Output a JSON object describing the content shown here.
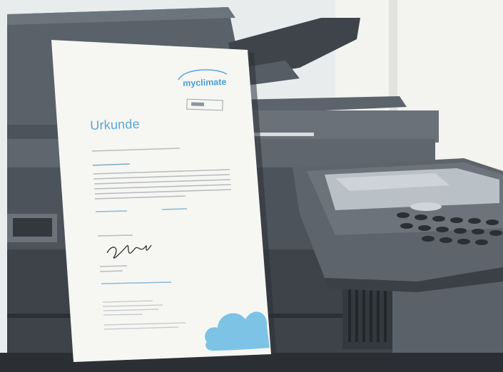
{
  "certificate": {
    "title": "Urkunde",
    "logo_text": "myclimate"
  },
  "colors": {
    "wall": "#eef1f2",
    "printer_body": "#4b5158",
    "printer_dark": "#2f3439",
    "paper": "#f7f7f5",
    "accent_blue": "#5aa7d6",
    "cloud_blue": "#7cc3e6"
  }
}
